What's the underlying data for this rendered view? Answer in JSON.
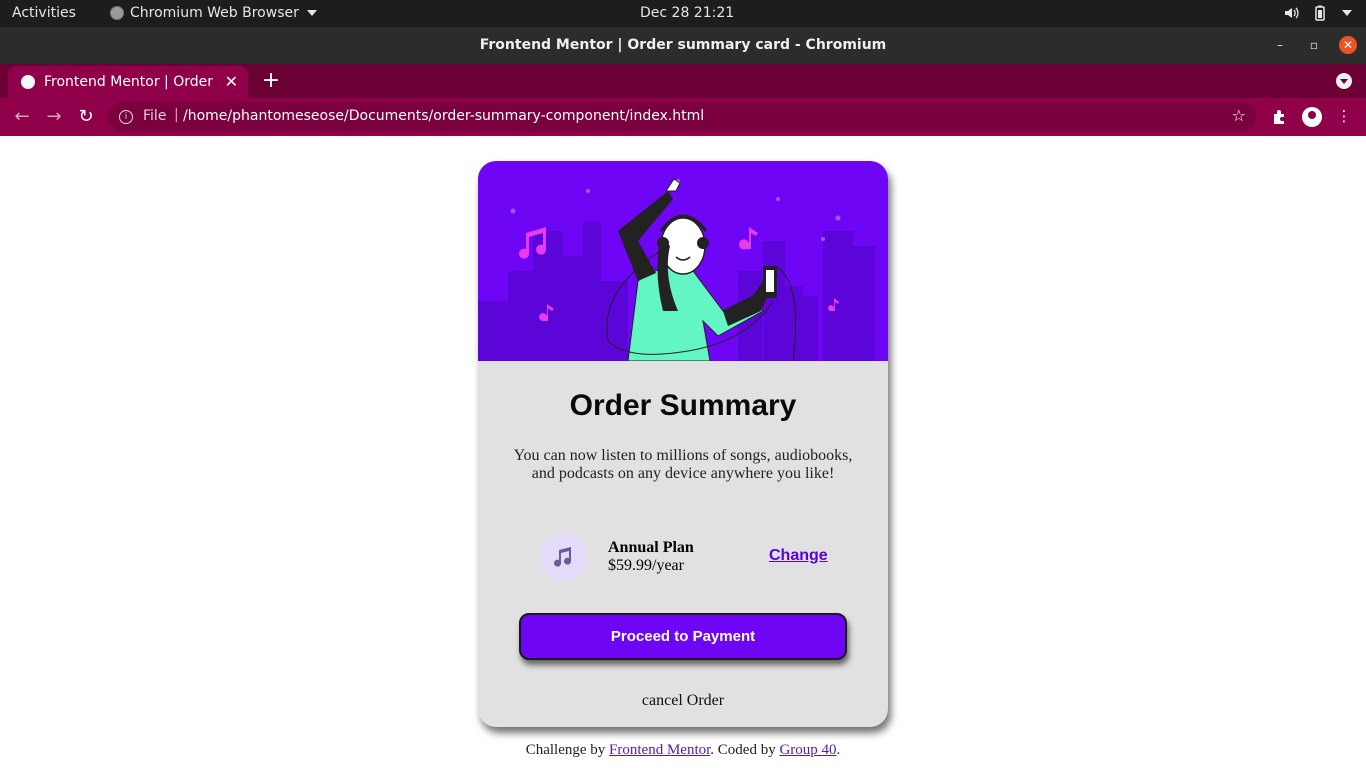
{
  "topbar": {
    "activities": "Activities",
    "app_name": "Chromium Web Browser",
    "clock": "Dec 28  21:21"
  },
  "window": {
    "title": "Frontend Mentor | Order summary card - Chromium"
  },
  "tabs": [
    {
      "label": "Frontend Mentor | Order summary card"
    }
  ],
  "toolbar": {
    "scheme": "File",
    "url": "/home/phantomeseose/Documents/order-summary-component/index.html"
  },
  "card": {
    "title": "Order Summary",
    "description": "You can now listen to millions of songs, audiobooks, and podcasts on any device anywhere you like!",
    "plan_name": "Annual Plan",
    "plan_price": "$59.99/year",
    "change_label": "Change",
    "proceed_label": "Proceed to Payment",
    "cancel_label": "cancel Order"
  },
  "footer": {
    "prefix": "Challenge by ",
    "challenge_link": "Frontend Mentor",
    "middle": ". Coded by ",
    "author_link": "Group 40",
    "suffix": "."
  },
  "colors": {
    "accent": "#6e05f5",
    "card_bg": "#e1e1e1",
    "tab_strip": "#6a0033",
    "toolbar": "#90004a"
  }
}
